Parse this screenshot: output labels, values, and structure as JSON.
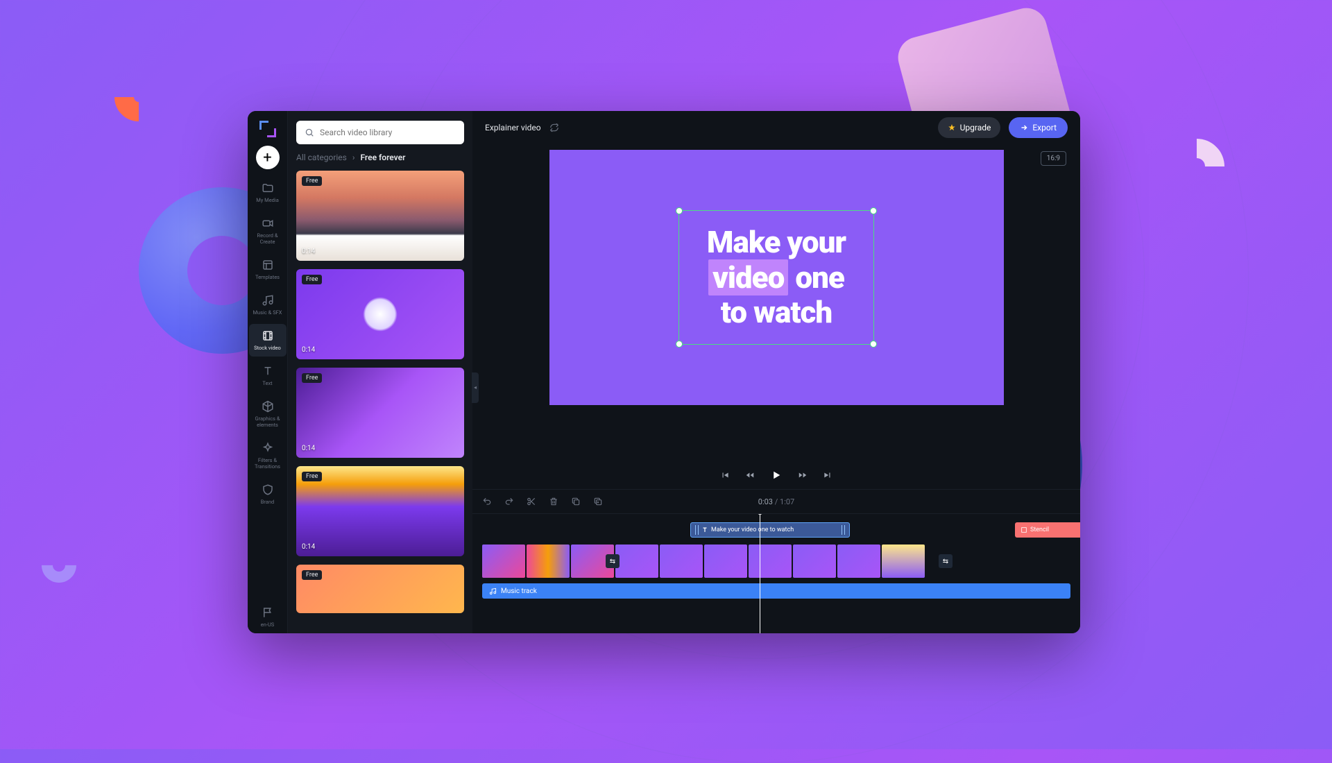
{
  "header": {
    "project_name": "Explainer video",
    "upgrade": "Upgrade",
    "export": "Export",
    "aspect_ratio": "16:9"
  },
  "search": {
    "placeholder": "Search video library"
  },
  "breadcrumb": {
    "root": "All categories",
    "sep": "›",
    "current": "Free forever"
  },
  "rail": {
    "my_media": "My Media",
    "record": "Record & Create",
    "templates": "Templates",
    "music": "Music & SFX",
    "stock": "Stock video",
    "text": "Text",
    "graphics": "Graphics & elements",
    "filters": "Filters & Transitions",
    "brand": "Brand",
    "locale": "en-US"
  },
  "clips": [
    {
      "badge": "Free",
      "duration": "0:14"
    },
    {
      "badge": "Free",
      "duration": "0:14"
    },
    {
      "badge": "Free",
      "duration": "0:14"
    },
    {
      "badge": "Free",
      "duration": "0:14"
    },
    {
      "badge": "Free",
      "duration": ""
    }
  ],
  "canvas": {
    "line1": "Make your",
    "highlight": "video",
    "line2_rest": " one",
    "line3": "to watch"
  },
  "timeline": {
    "current": "0:03",
    "sep": "/",
    "total": "1:07",
    "text_clip": "Make your video one to watch",
    "stencil": "Stencil",
    "music": "Music track"
  }
}
